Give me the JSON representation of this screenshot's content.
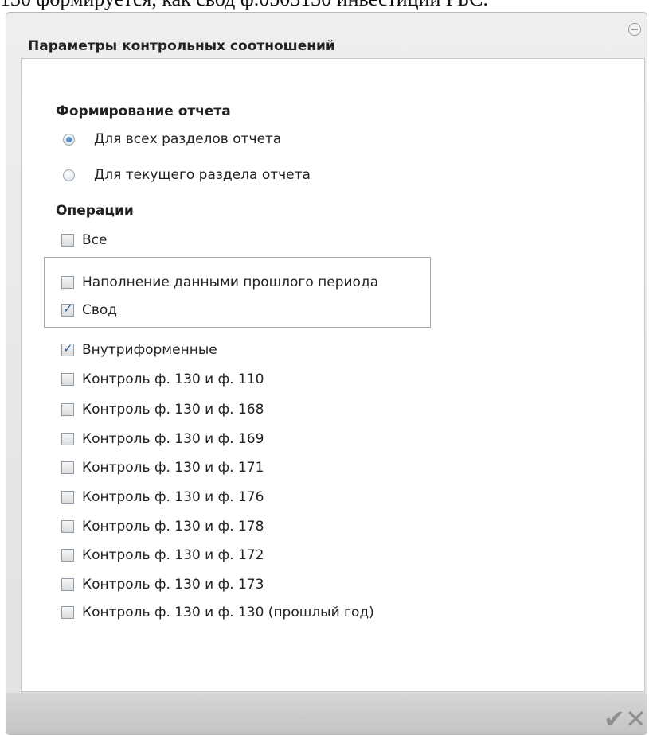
{
  "top_text": "130 формируется, как свод ф.0503130 инвестиций РБС.",
  "dialog": {
    "title": "Параметры контрольных соотношений"
  },
  "report": {
    "heading": "Формирование отчета",
    "options": [
      {
        "label": "Для всех разделов отчета",
        "selected": true
      },
      {
        "label": "Для текущего раздела отчета",
        "selected": false
      }
    ]
  },
  "operations": {
    "heading": "Операции",
    "all": {
      "label": "Все",
      "checked": false
    },
    "group": [
      {
        "label": "Наполнение данными прошлого периода",
        "checked": false
      },
      {
        "label": "Свод",
        "checked": true
      }
    ],
    "items": [
      {
        "label": "Внутриформенные",
        "checked": true
      },
      {
        "label": "Контроль ф. 130 и ф. 110",
        "checked": false
      },
      {
        "label": "Контроль ф. 130 и ф. 168",
        "checked": false
      },
      {
        "label": "Контроль ф. 130 и ф. 169",
        "checked": false
      },
      {
        "label": "Контроль ф. 130 и ф. 171",
        "checked": false
      },
      {
        "label": "Контроль ф. 130 и ф. 176",
        "checked": false
      },
      {
        "label": "Контроль ф. 130 и ф. 178",
        "checked": false
      },
      {
        "label": "Контроль ф. 130 и ф. 172",
        "checked": false
      },
      {
        "label": "Контроль ф. 130 и ф. 173",
        "checked": false
      },
      {
        "label": "Контроль ф. 130 и ф. 130 (прошлый год)",
        "checked": false
      }
    ]
  },
  "footer": {
    "ok_icon": "✔",
    "cancel_icon": "✕"
  }
}
